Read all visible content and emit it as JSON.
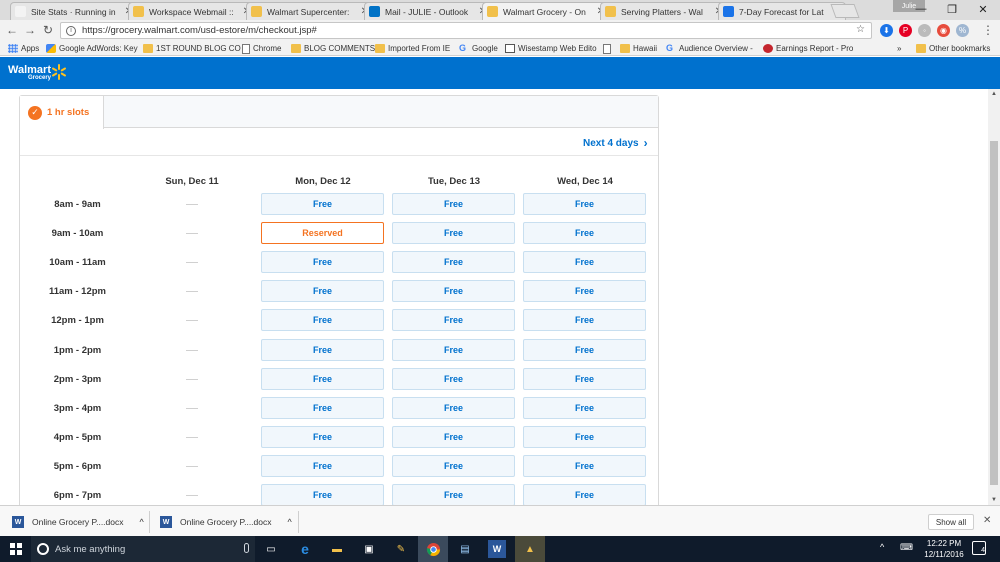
{
  "browser": {
    "tabs": [
      {
        "title": "Site Stats · Running in",
        "color": "#f3f3f3",
        "active": false
      },
      {
        "title": "Workspace Webmail ::",
        "color": "#f1c04b",
        "active": false
      },
      {
        "title": "Walmart Supercenter:",
        "color": "#f1c04b",
        "active": false
      },
      {
        "title": "Mail - JULIE - Outlook",
        "color": "#0072c6",
        "active": false
      },
      {
        "title": "Walmart Grocery - On",
        "color": "#f1c04b",
        "active": true
      },
      {
        "title": "Serving Platters - Wal",
        "color": "#f1c04b",
        "active": false
      },
      {
        "title": "7-Day Forecast for Lat",
        "color": "#1a73e8",
        "active": false
      }
    ],
    "profile": "Julie",
    "url": "https://grocery.walmart.com/usd-estore/m/checkout.jsp#",
    "bookmarks": [
      {
        "label": "Apps",
        "icon": "apps-grid-icon"
      },
      {
        "label": "Google AdWords: Key",
        "icon": "adwords-icon"
      },
      {
        "label": "1ST ROUND BLOG CO",
        "icon": "folder-icon"
      },
      {
        "label": "Chrome",
        "icon": "page-icon"
      },
      {
        "label": "BLOG COMMENTS",
        "icon": "folder-icon"
      },
      {
        "label": "Imported From IE",
        "icon": "folder-icon"
      },
      {
        "label": "Google",
        "icon": "google-icon"
      },
      {
        "label": "Wisestamp Web Edito",
        "icon": "wisestamp-icon"
      },
      {
        "label": "",
        "icon": "page-icon"
      },
      {
        "label": "Hawaii",
        "icon": "folder-icon"
      },
      {
        "label": "Audience Overview -",
        "icon": "google-icon"
      },
      {
        "label": "Earnings Report - Pro",
        "icon": "earnings-icon"
      },
      {
        "label": "»",
        "icon": ""
      },
      {
        "label": "Other bookmarks",
        "icon": "folder-icon"
      }
    ]
  },
  "header": {
    "brand": "Walmart",
    "sub": "Grocery"
  },
  "slots": {
    "active_tab": "1 hr slots",
    "next_link": "Next 4 days",
    "days": [
      "Sun, Dec 11",
      "Mon, Dec 12",
      "Tue, Dec 13",
      "Wed, Dec 14"
    ],
    "rows": [
      {
        "time": "8am - 9am",
        "cells": [
          "",
          "Free",
          "Free",
          "Free"
        ]
      },
      {
        "time": "9am - 10am",
        "cells": [
          "",
          "Reserved",
          "Free",
          "Free"
        ]
      },
      {
        "time": "10am - 11am",
        "cells": [
          "",
          "Free",
          "Free",
          "Free"
        ]
      },
      {
        "time": "11am - 12pm",
        "cells": [
          "",
          "Free",
          "Free",
          "Free"
        ]
      },
      {
        "time": "12pm - 1pm",
        "cells": [
          "",
          "Free",
          "Free",
          "Free"
        ]
      },
      {
        "time": "1pm - 2pm",
        "cells": [
          "",
          "Free",
          "Free",
          "Free"
        ]
      },
      {
        "time": "2pm - 3pm",
        "cells": [
          "",
          "Free",
          "Free",
          "Free"
        ]
      },
      {
        "time": "3pm - 4pm",
        "cells": [
          "",
          "Free",
          "Free",
          "Free"
        ]
      },
      {
        "time": "4pm - 5pm",
        "cells": [
          "",
          "Free",
          "Free",
          "Free"
        ]
      },
      {
        "time": "5pm - 6pm",
        "cells": [
          "",
          "Free",
          "Free",
          "Free"
        ]
      },
      {
        "time": "6pm - 7pm",
        "cells": [
          "",
          "Free",
          "Free",
          "Free"
        ]
      }
    ]
  },
  "downloads": {
    "items": [
      "Online Grocery P....docx",
      "Online Grocery P....docx"
    ],
    "show_all": "Show all"
  },
  "taskbar": {
    "search_placeholder": "Ask me anything",
    "time": "12:22 PM",
    "date": "12/11/2016",
    "notifications": "4"
  },
  "colors": {
    "walmart_blue": "#0071ce",
    "accent_orange": "#f47321"
  }
}
